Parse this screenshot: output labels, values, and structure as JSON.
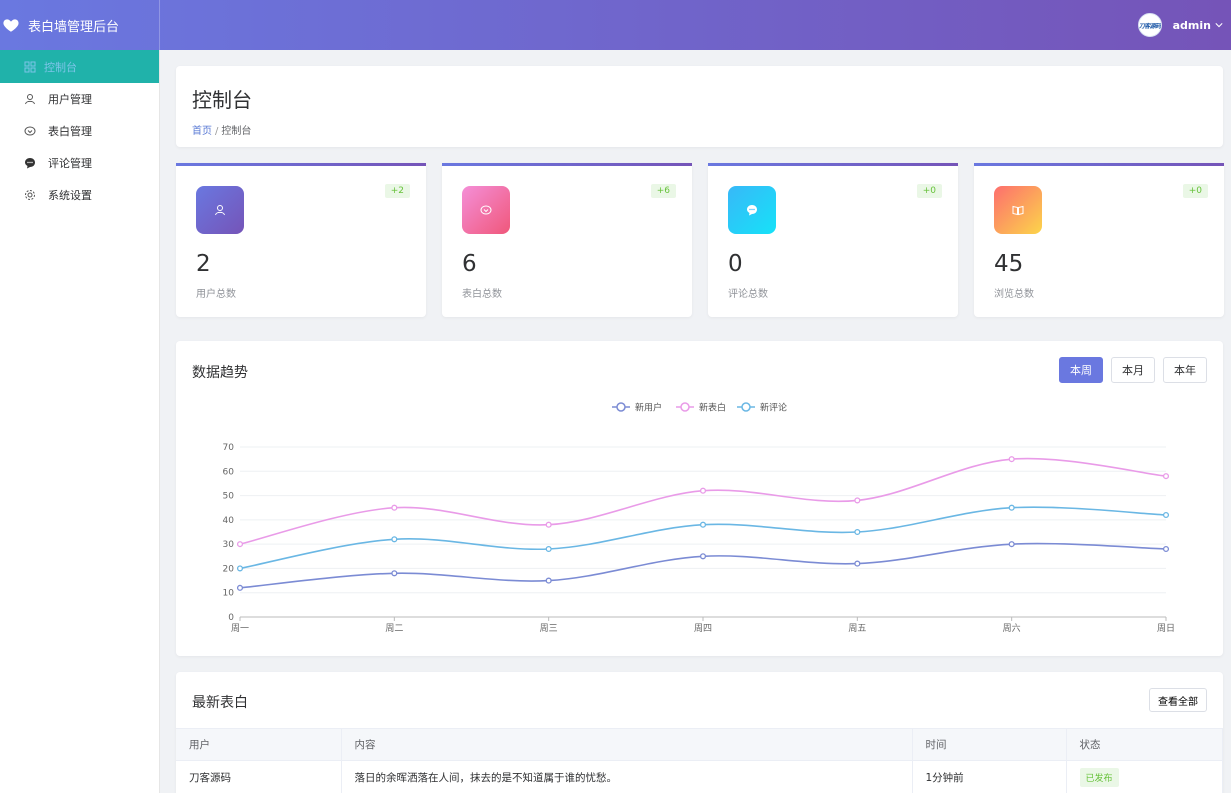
{
  "header": {
    "brand_title": "表白墙管理后台",
    "username": "admin",
    "avatar_text": "刀客源码"
  },
  "sidebar": {
    "items": [
      {
        "label": "控制台",
        "icon": "dashboard-icon"
      },
      {
        "label": "用户管理",
        "icon": "user-icon"
      },
      {
        "label": "表白管理",
        "icon": "heart-chat-icon"
      },
      {
        "label": "评论管理",
        "icon": "comment-icon"
      },
      {
        "label": "系统设置",
        "icon": "gear-icon"
      }
    ]
  },
  "page": {
    "title": "控制台",
    "breadcrumb_home": "首页",
    "breadcrumb_sep": "/",
    "breadcrumb_current": "控制台"
  },
  "stats": [
    {
      "value": "2",
      "label": "用户总数",
      "delta": "+2",
      "icon": "user-icon"
    },
    {
      "value": "6",
      "label": "表白总数",
      "delta": "+6",
      "icon": "heart-chat-icon"
    },
    {
      "value": "0",
      "label": "评论总数",
      "delta": "+0",
      "icon": "comment-icon"
    },
    {
      "value": "45",
      "label": "浏览总数",
      "delta": "+0",
      "icon": "book-icon"
    }
  ],
  "trend": {
    "title": "数据趋势",
    "ranges": [
      "本周",
      "本月",
      "本年"
    ],
    "active_range": "本周"
  },
  "chart_data": {
    "type": "line",
    "categories": [
      "周一",
      "周二",
      "周三",
      "周四",
      "周五",
      "周六",
      "周日"
    ],
    "series": [
      {
        "name": "新用户",
        "color": "#7b8bd4",
        "values": [
          12,
          18,
          15,
          25,
          22,
          30,
          28
        ]
      },
      {
        "name": "新表白",
        "color": "#e99be8",
        "values": [
          30,
          45,
          38,
          52,
          48,
          65,
          58
        ]
      },
      {
        "name": "新评论",
        "color": "#6ab7e4",
        "values": [
          20,
          32,
          28,
          38,
          35,
          45,
          42
        ]
      }
    ],
    "yticks": [
      "0",
      "10",
      "20",
      "30",
      "40",
      "50",
      "60",
      "70"
    ],
    "ylim": [
      0,
      70
    ],
    "legend": "top-center",
    "grid": true
  },
  "latest": {
    "title": "最新表白",
    "view_all": "查看全部",
    "columns": [
      "用户",
      "内容",
      "时间",
      "状态"
    ],
    "rows": [
      {
        "user": "刀客源码",
        "content": "落日的余晖洒落在人间，抹去的是不知道属于谁的忧愁。",
        "time": "1分钟前",
        "status": "已发布"
      }
    ]
  }
}
